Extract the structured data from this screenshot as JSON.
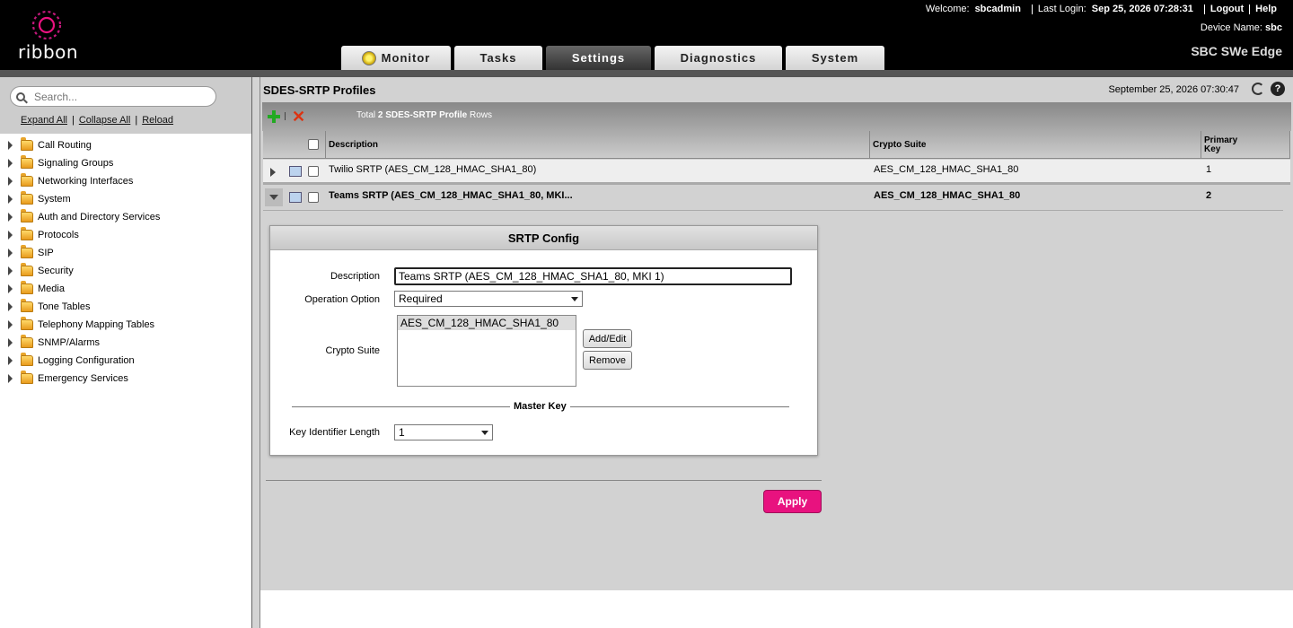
{
  "header": {
    "logo_text": "ribbon",
    "welcome_label": "Welcome:",
    "username": "sbcadmin",
    "last_login_label": "Last Login:",
    "last_login": "Sep 25, 2026 07:28:31",
    "logout": "Logout",
    "help": "Help",
    "device_label": "Device Name:",
    "device_name": "sbc",
    "product": "SBC SWe Edge",
    "tabs": [
      {
        "label": "Monitor",
        "active": false
      },
      {
        "label": "Tasks",
        "active": false
      },
      {
        "label": "Settings",
        "active": true
      },
      {
        "label": "Diagnostics",
        "active": false
      },
      {
        "label": "System",
        "active": false
      }
    ]
  },
  "sidebar": {
    "search_placeholder": "Search...",
    "expand_all": "Expand All",
    "collapse_all": "Collapse All",
    "reload": "Reload",
    "items": [
      "Call Routing",
      "Signaling Groups",
      "Networking Interfaces",
      "System",
      "Auth and Directory Services",
      "Protocols",
      "SIP",
      "Security",
      "Media",
      "Tone Tables",
      "Telephony Mapping Tables",
      "SNMP/Alarms",
      "Logging Configuration",
      "Emergency Services"
    ]
  },
  "main": {
    "title": "SDES-SRTP Profiles",
    "datetime": "September 25, 2026 07:30:47",
    "toolbar": {
      "total_prefix": "Total",
      "total_bold": "2 SDES-SRTP Profile",
      "total_suffix": "Rows"
    },
    "columns": {
      "description": "Description",
      "crypto_suite": "Crypto Suite",
      "primary_key_1": "Primary",
      "primary_key_2": "Key"
    },
    "rows": [
      {
        "description": "Twilio SRTP (AES_CM_128_HMAC_SHA1_80)",
        "crypto_suite": "AES_CM_128_HMAC_SHA1_80",
        "key": "1"
      },
      {
        "description": "Teams SRTP (AES_CM_128_HMAC_SHA1_80, MKI...",
        "crypto_suite": "AES_CM_128_HMAC_SHA1_80",
        "key": "2"
      }
    ],
    "panel": {
      "title": "SRTP Config",
      "description_label": "Description",
      "description_value": "Teams SRTP (AES_CM_128_HMAC_SHA1_80, MKI 1)",
      "operation_label": "Operation Option",
      "operation_value": "Required",
      "crypto_label": "Crypto Suite",
      "crypto_options": [
        "AES_CM_128_HMAC_SHA1_80"
      ],
      "add_edit": "Add/Edit",
      "remove": "Remove",
      "master_key": "Master Key",
      "key_id_label": "Key Identifier Length",
      "key_id_value": "1"
    },
    "apply": "Apply"
  },
  "colors": {
    "apply_button": "#e8127f",
    "add_icon": "#22aa22",
    "delete_icon": "#dd3311",
    "logo": "#e8127f"
  }
}
